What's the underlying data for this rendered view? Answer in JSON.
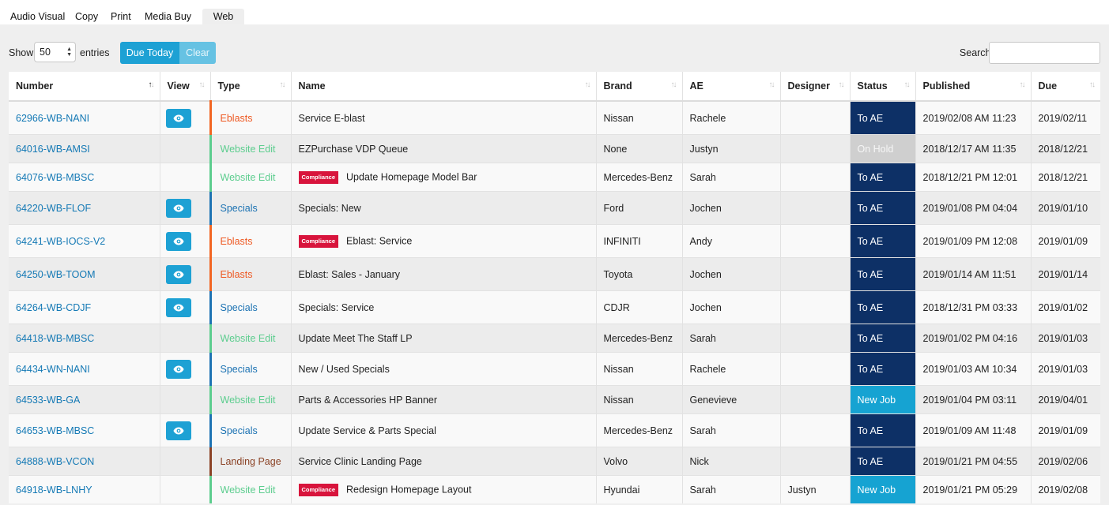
{
  "tabs": [
    {
      "label": "Audio Visual",
      "active": false
    },
    {
      "label": "Copy",
      "active": false
    },
    {
      "label": "Print",
      "active": false
    },
    {
      "label": "Media Buy",
      "active": false
    },
    {
      "label": "Web",
      "active": true
    }
  ],
  "controls": {
    "show_label": "Show",
    "entries_value": "50",
    "entries_label": "entries",
    "due_today_label": "Due Today",
    "clear_label": "Clear",
    "search_label": "Search:",
    "search_value": ""
  },
  "table": {
    "columns": [
      "Number",
      "View",
      "Type",
      "Name",
      "Brand",
      "AE",
      "Designer",
      "Status",
      "Published",
      "Due"
    ],
    "sorted_column": "Number",
    "rows": [
      {
        "number": "62966-WB-NANI",
        "view": true,
        "type": "Eblasts",
        "compliance": false,
        "name": "Service E-blast",
        "brand": "Nissan",
        "ae": "Rachele",
        "designer": "",
        "status": "To AE",
        "published": "2019/02/08 AM 11:23",
        "due": "2019/02/11"
      },
      {
        "number": "64016-WB-AMSI",
        "view": false,
        "type": "Website Edit",
        "compliance": false,
        "name": "EZPurchase VDP Queue",
        "brand": "None",
        "ae": "Justyn",
        "designer": "",
        "status": "On Hold",
        "published": "2018/12/17 AM 11:35",
        "due": "2018/12/21"
      },
      {
        "number": "64076-WB-MBSC",
        "view": false,
        "type": "Website Edit",
        "compliance": true,
        "name": "Update Homepage Model Bar",
        "brand": "Mercedes-Benz",
        "ae": "Sarah",
        "designer": "",
        "status": "To AE",
        "published": "2018/12/21 PM 12:01",
        "due": "2018/12/21"
      },
      {
        "number": "64220-WB-FLOF",
        "view": true,
        "type": "Specials",
        "compliance": false,
        "name": "Specials: New",
        "brand": "Ford",
        "ae": "Jochen",
        "designer": "",
        "status": "To AE",
        "published": "2019/01/08 PM 04:04",
        "due": "2019/01/10"
      },
      {
        "number": "64241-WB-IOCS-V2",
        "view": true,
        "type": "Eblasts",
        "compliance": true,
        "name": "Eblast: Service",
        "brand": "INFINITI",
        "ae": "Andy",
        "designer": "",
        "status": "To AE",
        "published": "2019/01/09 PM 12:08",
        "due": "2019/01/09"
      },
      {
        "number": "64250-WB-TOOM",
        "view": true,
        "type": "Eblasts",
        "compliance": false,
        "name": "Eblast: Sales - January",
        "brand": "Toyota",
        "ae": "Jochen",
        "designer": "",
        "status": "To AE",
        "published": "2019/01/14 AM 11:51",
        "due": "2019/01/14"
      },
      {
        "number": "64264-WB-CDJF",
        "view": true,
        "type": "Specials",
        "compliance": false,
        "name": "Specials: Service",
        "brand": "CDJR",
        "ae": "Jochen",
        "designer": "",
        "status": "To AE",
        "published": "2018/12/31 PM 03:33",
        "due": "2019/01/02"
      },
      {
        "number": "64418-WB-MBSC",
        "view": false,
        "type": "Website Edit",
        "compliance": false,
        "name": "Update Meet The Staff LP",
        "brand": "Mercedes-Benz",
        "ae": "Sarah",
        "designer": "",
        "status": "To AE",
        "published": "2019/01/02 PM 04:16",
        "due": "2019/01/03"
      },
      {
        "number": "64434-WN-NANI",
        "view": true,
        "type": "Specials",
        "compliance": false,
        "name": "New / Used Specials",
        "brand": "Nissan",
        "ae": "Rachele",
        "designer": "",
        "status": "To AE",
        "published": "2019/01/03 AM 10:34",
        "due": "2019/01/03"
      },
      {
        "number": "64533-WB-GA",
        "view": false,
        "type": "Website Edit",
        "compliance": false,
        "name": "Parts & Accessories HP Banner",
        "brand": "Nissan",
        "ae": "Genevieve",
        "designer": "",
        "status": "New Job",
        "published": "2019/01/04 PM 03:11",
        "due": "2019/04/01"
      },
      {
        "number": "64653-WB-MBSC",
        "view": true,
        "type": "Specials",
        "compliance": false,
        "name": "Update Service & Parts Special",
        "brand": "Mercedes-Benz",
        "ae": "Sarah",
        "designer": "",
        "status": "To AE",
        "published": "2019/01/09 AM 11:48",
        "due": "2019/01/09"
      },
      {
        "number": "64888-WB-VCON",
        "view": false,
        "type": "Landing Page",
        "compliance": false,
        "name": "Service Clinic Landing Page",
        "brand": "Volvo",
        "ae": "Nick",
        "designer": "",
        "status": "To AE",
        "published": "2019/01/21 PM 04:55",
        "due": "2019/02/06"
      },
      {
        "number": "64918-WB-LNHY",
        "view": false,
        "type": "Website Edit",
        "compliance": true,
        "name": "Redesign Homepage Layout",
        "brand": "Hyundai",
        "ae": "Sarah",
        "designer": "Justyn",
        "status": "New Job",
        "published": "2019/01/21 PM 05:29",
        "due": "2019/02/08"
      }
    ],
    "compliance_label": "Compliance",
    "view_icon": "eye-icon"
  },
  "colors": {
    "eblasts": "#f26522",
    "website_edit": "#5ccd8e",
    "specials": "#1d73b3",
    "landing_page": "#8b4326",
    "status_to_ae": "#0d3066",
    "status_on_hold": "#cfcfcf",
    "status_new_job": "#16a3d2",
    "accent": "#1da1d4"
  }
}
